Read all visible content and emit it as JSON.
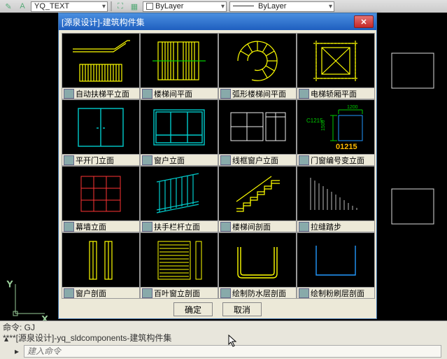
{
  "toolbar": {
    "dd1": "YQ_TEXT",
    "dd2": "ByLayer",
    "dd3": "ByLayer"
  },
  "dialog": {
    "title": "[源泉设计]-建筑构件集",
    "ok": "确定",
    "cancel": "取消"
  },
  "cells": [
    {
      "label": "自动扶梯平立面"
    },
    {
      "label": "楼梯间平面"
    },
    {
      "label": "弧形楼梯间平面"
    },
    {
      "label": "电梯轿厢平面"
    },
    {
      "label": "平开门立面"
    },
    {
      "label": "窗户立面"
    },
    {
      "label": "线框窗户立面"
    },
    {
      "label": "门窗编号变立面"
    },
    {
      "label": "幕墙立面"
    },
    {
      "label": "扶手栏杆立面"
    },
    {
      "label": "楼梯间剖面"
    },
    {
      "label": "拉缝踏步"
    },
    {
      "label": "窗户剖面"
    },
    {
      "label": "百叶窗立剖面"
    },
    {
      "label": "绘制防水层剖面"
    },
    {
      "label": "绘制粉刷层剖面"
    }
  ],
  "dims": {
    "w": "1200",
    "h": "1500",
    "code": "C1215",
    "codeBig": "01215"
  },
  "cmd": {
    "line1": "命令: GJ",
    "line2": "****[源泉设计]-yq_sldcomponents-建筑构件集",
    "placeholder": "建入命令"
  }
}
